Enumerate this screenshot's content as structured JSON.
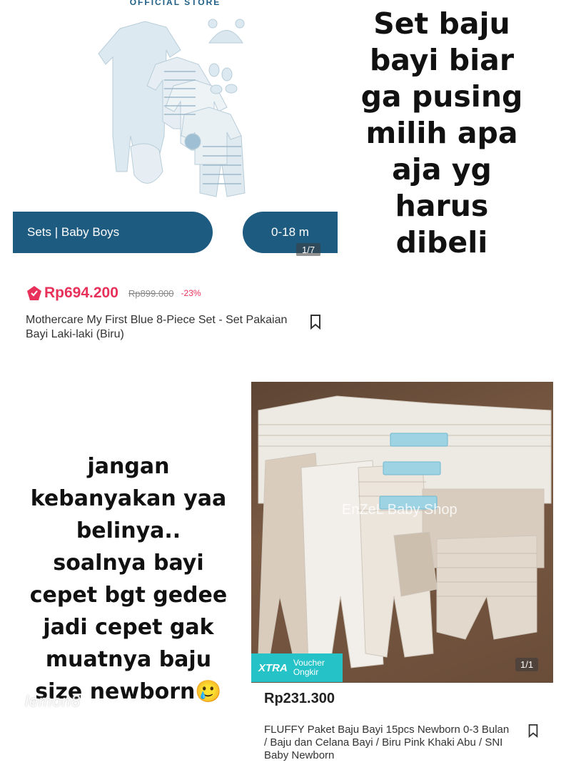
{
  "product1": {
    "store_label": "OFFICIAL STORE",
    "band_left": "Sets | Baby Boys",
    "band_right": "0-18 m",
    "image_counter": "1/7",
    "price": "Rp694.200",
    "old_price": "Rp899.000",
    "discount": "-23%",
    "title": "Mothercare My First Blue 8-Piece Set - Set Pakaian Bayi Laki-laki (Biru)"
  },
  "headline": "Set baju bayi biar ga pusing milih apa aja yg harus dibeli",
  "middle_text": "jangan kebanyakan yaa belinya.. soalnya bayi cepet bgt gedee jadi cepet gak muatnya baju size newborn🥲",
  "watermark": "lemon8",
  "product2": {
    "watermark_text": "EnZeL Baby Shop",
    "xtra": "XTRA",
    "voucher": "Voucher Ongkir",
    "image_counter": "1/1",
    "price": "Rp231.300",
    "title": "FLUFFY Paket Baju Bayi 15pcs Newborn 0-3 Bulan / Baju dan Celana Bayi / Biru Pink Khaki Abu / SNI Baby Newborn"
  },
  "colors": {
    "brand_blue": "#1d5b80",
    "price_red": "#e8315a",
    "xtra_teal": "#25c2c7"
  },
  "icons": [
    "official-store-icon",
    "bookmark-icon"
  ]
}
